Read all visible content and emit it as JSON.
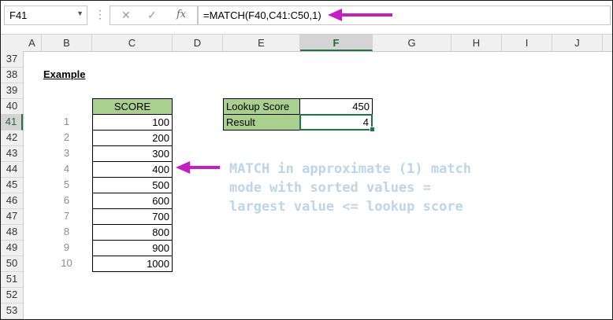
{
  "formula_bar": {
    "name_box": "F41",
    "name_box_dropdown": "▼",
    "dots": "⋮",
    "cancel_glyph": "✕",
    "enter_glyph": "✓",
    "fx_glyph": "fx",
    "formula": "=MATCH(F40,C41:C50,1)"
  },
  "columns": [
    "A",
    "B",
    "C",
    "D",
    "E",
    "F",
    "G",
    "H",
    "I",
    "J"
  ],
  "selected_column": "F",
  "rows": [
    "37",
    "38",
    "39",
    "40",
    "41",
    "42",
    "43",
    "44",
    "45",
    "46",
    "47",
    "48",
    "49",
    "50",
    "51",
    "52",
    "53"
  ],
  "selected_row": "41",
  "sheet": {
    "example_label": "Example",
    "score_header": "SCORE",
    "indices": [
      "1",
      "2",
      "3",
      "4",
      "5",
      "6",
      "7",
      "8",
      "9",
      "10"
    ],
    "scores": [
      "100",
      "200",
      "300",
      "400",
      "500",
      "600",
      "700",
      "800",
      "900",
      "1000"
    ],
    "lookup_label": "Lookup Score",
    "lookup_value": "450",
    "result_label": "Result",
    "result_value": "4"
  },
  "annotation": {
    "line1": "MATCH in approximate (1) match",
    "line2": "mode with sorted values =",
    "line3": "largest value <= lookup score"
  },
  "colors": {
    "header_fill": "#a9d08e",
    "selection_green": "#217346",
    "arrow_magenta": "#c41fc4",
    "note_blue": "#bcd5ea"
  }
}
